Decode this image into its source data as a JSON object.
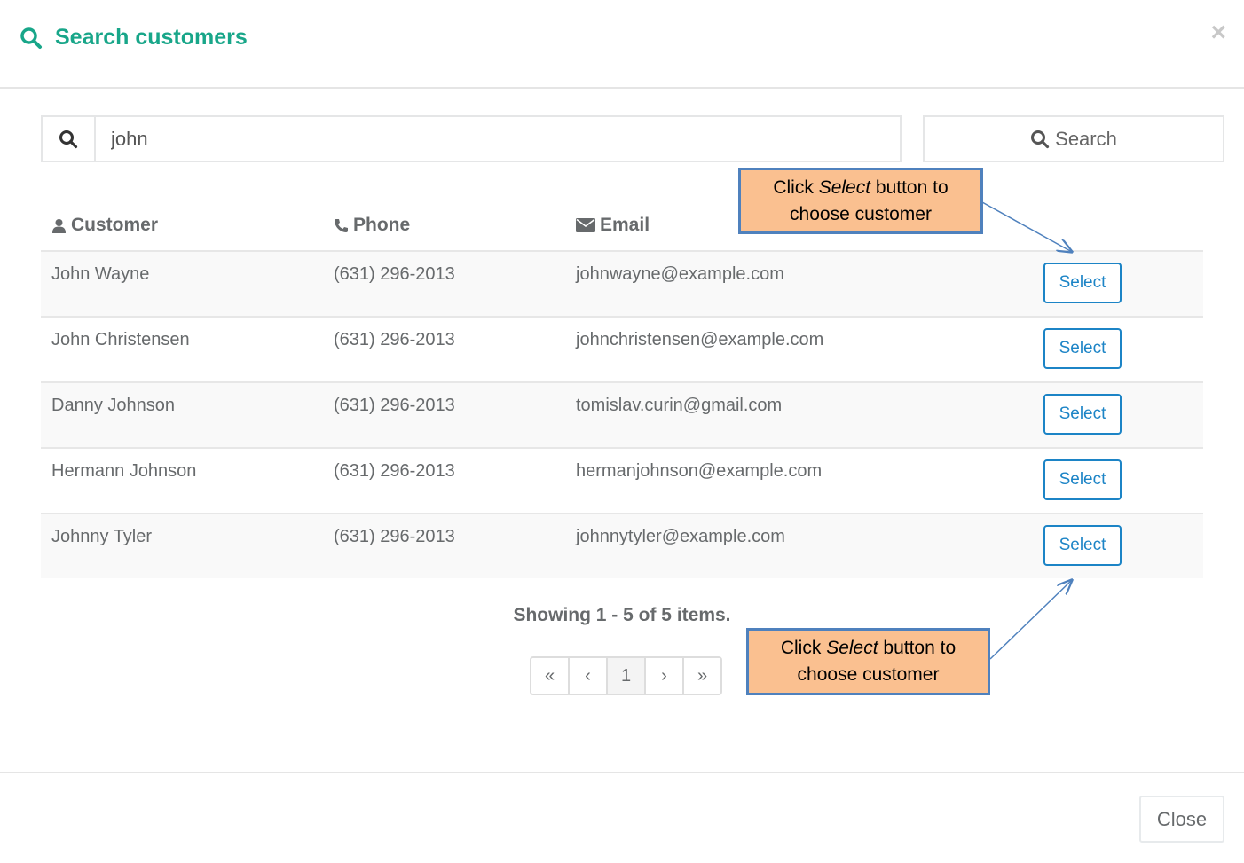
{
  "modal": {
    "title": "Search customers",
    "title_color": "#18a689",
    "close_symbol": "×",
    "title_icon": "search-icon"
  },
  "search": {
    "value": "john",
    "button_label": "Search",
    "icon": "search-icon"
  },
  "table": {
    "headers": {
      "customer": "Customer",
      "phone": "Phone",
      "email": "Email"
    },
    "header_icons": {
      "customer": "user-icon",
      "phone": "phone-icon",
      "email": "envelope-icon"
    },
    "rows": [
      {
        "name": "John Wayne",
        "phone": "(631) 296-2013",
        "email": "johnwayne@example.com",
        "action": "Select"
      },
      {
        "name": "John Christensen",
        "phone": "(631) 296-2013",
        "email": "johnchristensen@example.com",
        "action": "Select"
      },
      {
        "name": "Danny Johnson",
        "phone": "(631) 296-2013",
        "email": "tomislav.curin@gmail.com",
        "action": "Select"
      },
      {
        "name": "Hermann Johnson",
        "phone": "(631) 296-2013",
        "email": "hermanjohnson@example.com",
        "action": "Select"
      },
      {
        "name": "Johnny Tyler",
        "phone": "(631) 296-2013",
        "email": "johnnytyler@example.com",
        "action": "Select"
      }
    ]
  },
  "summary": "Showing 1 - 5 of 5 items.",
  "pagination": {
    "first": "«",
    "prev": "‹",
    "current": "1",
    "next": "›",
    "last": "»"
  },
  "callouts": {
    "top": {
      "prefix": "Click ",
      "emphasis": "Select",
      "suffix": " button to",
      "line2": "choose customer"
    },
    "bottom": {
      "prefix": "Click ",
      "emphasis": "Select",
      "suffix": " button to",
      "line2": "choose customer"
    },
    "fill_color": "#fac090",
    "border_color": "#4f81bd"
  },
  "footer": {
    "close_label": "Close"
  },
  "colors": {
    "accent": "#18a689",
    "select_button": "#1c84c6"
  }
}
